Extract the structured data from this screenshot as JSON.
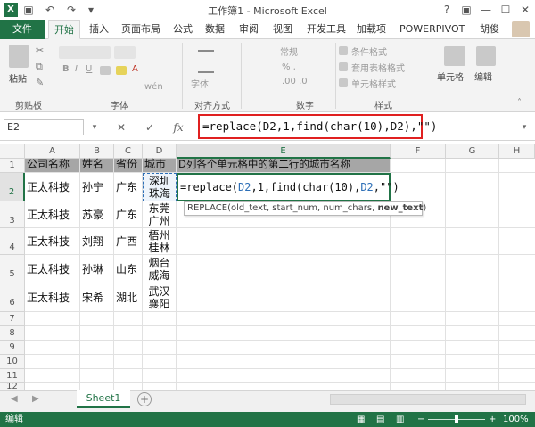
{
  "window": {
    "title": "工作簿1 - Microsoft Excel",
    "controls": [
      "?",
      "▣",
      "—",
      "☐",
      "✕"
    ]
  },
  "ribbon_tabs": [
    "文件",
    "开始",
    "插入",
    "页面布局",
    "公式",
    "数据",
    "审阅",
    "视图",
    "开发工具",
    "加载项",
    "POWERPIVOT"
  ],
  "active_tab": "开始",
  "user": "胡俊",
  "ribbon_groups": {
    "clipboard": {
      "paste": "粘贴",
      "label": "剪贴板"
    },
    "font": {
      "label": "字体",
      "icon_button": "字体"
    },
    "alignment": {
      "icon_button": "对齐方式"
    },
    "number": {
      "format": "常规",
      "label": "数字"
    },
    "styles": {
      "items": [
        "条件格式",
        "套用表格格式",
        "单元格样式"
      ],
      "label": "样式"
    },
    "cells": {
      "label": "单元格"
    },
    "editing": {
      "label": "编辑"
    }
  },
  "formula_bar": {
    "name_box": "E2",
    "formula": "=replace(D2,1,find(char(10),D2),\"\")",
    "fx": "fx"
  },
  "columns": [
    "A",
    "B",
    "C",
    "D",
    "E",
    "F",
    "G",
    "H"
  ],
  "rows": [
    "1",
    "2",
    "3",
    "4",
    "5",
    "6",
    "7",
    "8",
    "9",
    "10",
    "11",
    "12"
  ],
  "cells": {
    "header": [
      "公司名称",
      "姓名",
      "省份",
      "城市",
      "D列各个单元格中的第二行的城市名称"
    ],
    "data": [
      [
        "正太科技",
        "孙宁",
        "广东",
        "深圳\n珠海"
      ],
      [
        "正太科技",
        "苏豪",
        "广东",
        "东莞\n广州"
      ],
      [
        "正太科技",
        "刘翔",
        "广西",
        "梧州\n桂林"
      ],
      [
        "正太科技",
        "孙琳",
        "山东",
        "烟台\n威海"
      ],
      [
        "正太科技",
        "宋希",
        "湖北",
        "武汉\n襄阳"
      ]
    ],
    "e2_edit": {
      "pre": "=replace(",
      "ref1": "D2",
      "mid": ",1,find(char(10),",
      "ref2": "D2",
      "post": ",\"\")"
    }
  },
  "tooltip": {
    "text": "REPLACE(old_text, start_num, num_chars, ",
    "bold": "new_text",
    "close": ")"
  },
  "sheet": {
    "name": "Sheet1"
  },
  "status": {
    "mode": "编辑",
    "zoom": "100%"
  },
  "colors": {
    "accent": "#217346",
    "highlight": "#a6a6a6",
    "formula_border": "#e02020"
  }
}
